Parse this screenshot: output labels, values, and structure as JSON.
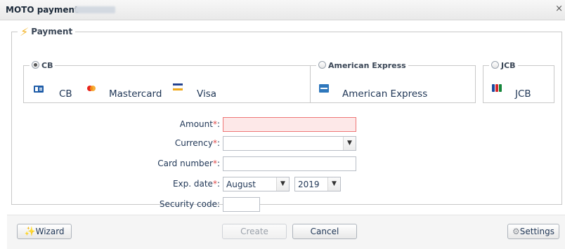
{
  "window": {
    "title": "MOTO payment",
    "close_label": "×"
  },
  "payment": {
    "legend": "Payment",
    "groups": {
      "cb": {
        "label": "CB",
        "selected": true,
        "brands": [
          "CB",
          "Mastercard",
          "Visa"
        ]
      },
      "amex": {
        "label": "American Express",
        "selected": false,
        "brands": [
          "American Express"
        ]
      },
      "jcb": {
        "label": "JCB",
        "selected": false,
        "brands": [
          "JCB"
        ]
      }
    }
  },
  "form": {
    "amount": {
      "label": "Amount",
      "required": "*",
      "suffix": ":",
      "value": ""
    },
    "currency": {
      "label": "Currency",
      "required": "*",
      "suffix": ":",
      "value": ""
    },
    "card_number": {
      "label": "Card number",
      "required": "*",
      "suffix": ":",
      "value": ""
    },
    "exp_date": {
      "label": "Exp. date",
      "required": "*",
      "suffix": ":",
      "month": "August",
      "year": "2019"
    },
    "security_code": {
      "label": "Security code:",
      "value": ""
    }
  },
  "footer": {
    "wizard": "Wizard",
    "create": "Create",
    "cancel": "Cancel",
    "settings": "Settings"
  },
  "colors": {
    "error_border": "#e77",
    "error_bg": "#fde8e8",
    "required": "#e04a4a",
    "brand_blue": "#1e3555"
  }
}
